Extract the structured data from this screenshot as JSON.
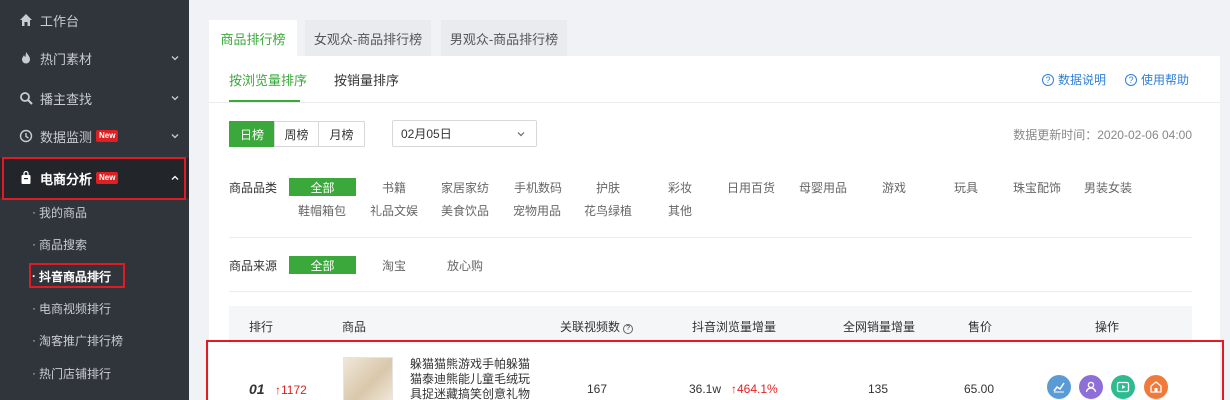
{
  "sidebar": {
    "items": [
      {
        "label": "工作台"
      },
      {
        "label": "热门素材"
      },
      {
        "label": "播主查找"
      },
      {
        "label": "数据监测",
        "badge": "New"
      },
      {
        "label": "电商分析",
        "badge": "New"
      }
    ],
    "sub_items": [
      {
        "label": "我的商品"
      },
      {
        "label": "商品搜索"
      },
      {
        "label": "抖音商品排行"
      },
      {
        "label": "电商视频排行"
      },
      {
        "label": "淘客推广排行榜"
      },
      {
        "label": "热门店铺排行"
      }
    ]
  },
  "main": {
    "top_tabs": [
      {
        "label": "商品排行榜"
      },
      {
        "label": "女观众-商品排行榜"
      },
      {
        "label": "男观众-商品排行榜"
      }
    ],
    "sub_tabs": [
      {
        "label": "按浏览量排序"
      },
      {
        "label": "按销量排序"
      }
    ],
    "help_links": [
      {
        "label": "数据说明"
      },
      {
        "label": "使用帮助"
      }
    ],
    "period": [
      "日榜",
      "周榜",
      "月榜"
    ],
    "date_value": "02月05日",
    "update_time": "数据更新时间：2020-02-06 04:00",
    "category": {
      "label": "商品品类",
      "options": [
        "全部",
        "书籍",
        "家居家纺",
        "手机数码",
        "护肤",
        "彩妆",
        "日用百货",
        "母婴用品",
        "游戏",
        "玩具",
        "珠宝配饰",
        "男装女装",
        "鞋帽箱包",
        "礼品文娱",
        "美食饮品",
        "宠物用品",
        "花鸟绿植",
        "其他"
      ]
    },
    "source": {
      "label": "商品来源",
      "options": [
        "全部",
        "淘宝",
        "放心购"
      ]
    },
    "table": {
      "headers": [
        "排行",
        "商品",
        "关联视频数",
        "抖音浏览量增量",
        "全网销量增量",
        "售价",
        "操作"
      ],
      "row": {
        "rank": "01",
        "rank_change": "↑1172",
        "title_lines": [
          "躲猫猫熊游戏手帕躲猫",
          "猫泰迪熊能儿童毛绒玩",
          "具捉迷藏搞笑创意礼物"
        ],
        "video_count": "167",
        "views": "36.1w",
        "views_growth": "↑464.1%",
        "sales": "135",
        "price": "65.00"
      }
    }
  },
  "colors": {
    "accent_green": "#3aa83a",
    "highlight_red": "#e01b24",
    "link_blue": "#2f7fd8",
    "sidebar_bg": "#30343b"
  }
}
